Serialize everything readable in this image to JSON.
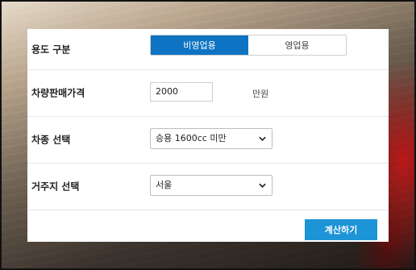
{
  "form": {
    "usage": {
      "label": "용도 구분",
      "options": [
        "비영업용",
        "영업용"
      ],
      "selected_index": 0
    },
    "price": {
      "label": "차량판매가격",
      "value": "2000",
      "unit": "만원"
    },
    "car_type": {
      "label": "차종 선택",
      "value": "승용 1600cc 미만"
    },
    "residence": {
      "label": "거주지 선택",
      "value": "서울"
    },
    "submit_label": "계산하기"
  },
  "colors": {
    "accent": "#0d73c2",
    "button": "#1c94d6"
  },
  "icons": {
    "dropdown": "chevron-down-icon"
  }
}
